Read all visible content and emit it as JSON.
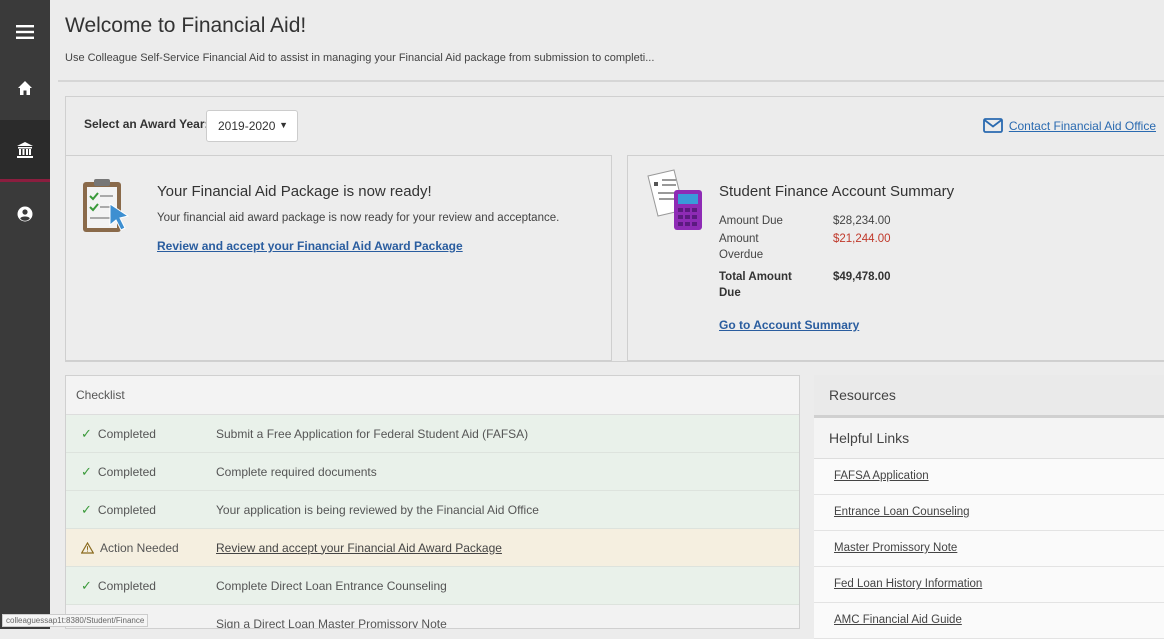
{
  "page": {
    "title": "Welcome to Financial Aid!",
    "subtitle": "Use Colleague Self-Service Financial Aid to assist in managing your Financial Aid package from submission to completi..."
  },
  "sidebar": {
    "items": [
      {
        "icon": "menu-icon"
      },
      {
        "icon": "home-icon"
      },
      {
        "icon": "bank-icon"
      },
      {
        "icon": "user-icon"
      }
    ]
  },
  "award_year": {
    "label": "Select an Award Year:",
    "value": "2019-2020"
  },
  "contact": {
    "label": "Contact Financial Aid Office"
  },
  "aid_package": {
    "title": "Your Financial Aid Package is now ready!",
    "text": "Your financial aid award package is now ready for your review and acceptance.",
    "link": "Review and accept your Financial Aid Award Package"
  },
  "account_summary": {
    "title": "Student Finance Account Summary",
    "amount_due_label": "Amount Due",
    "amount_due_value": "$28,234.00",
    "overdue_label_1": "Amount",
    "overdue_label_2": "Overdue",
    "overdue_value": "$21,244.00",
    "total_label_1": "Total Amount",
    "total_label_2": "Due",
    "total_value": "$49,478.00",
    "link": "Go to Account Summary",
    "overdue_color": "#c0392b"
  },
  "checklist": {
    "header": "Checklist",
    "rows": [
      {
        "status": "Completed",
        "desc": "Submit a Free Application for Federal Student Aid (FAFSA)"
      },
      {
        "status": "Completed",
        "desc": "Complete required documents"
      },
      {
        "status": "Completed",
        "desc": "Your application is being reviewed by the Financial Aid Office"
      },
      {
        "status": "Action Needed",
        "desc": "Review and accept your Financial Aid Award Package"
      },
      {
        "status": "Completed",
        "desc": "Complete Direct Loan Entrance Counseling"
      },
      {
        "status": "",
        "desc": "Sign a Direct Loan Master Promissory Note"
      }
    ]
  },
  "resources": {
    "header": "Resources",
    "helpful_header": "Helpful Links",
    "links": [
      "FAFSA Application",
      "Entrance Loan Counseling",
      "Master Promissory Note",
      "Fed Loan History Information",
      "AMC Financial Aid Guide"
    ]
  },
  "status_bar": {
    "url": "colleaguessap1t:8380/Student/Finance"
  },
  "colors": {
    "sidebar": "#3a3a3a",
    "accent": "#8b1e3f",
    "link": "#2a5d9f",
    "success": "#3a9a3a",
    "warning": "#c08a1e"
  }
}
